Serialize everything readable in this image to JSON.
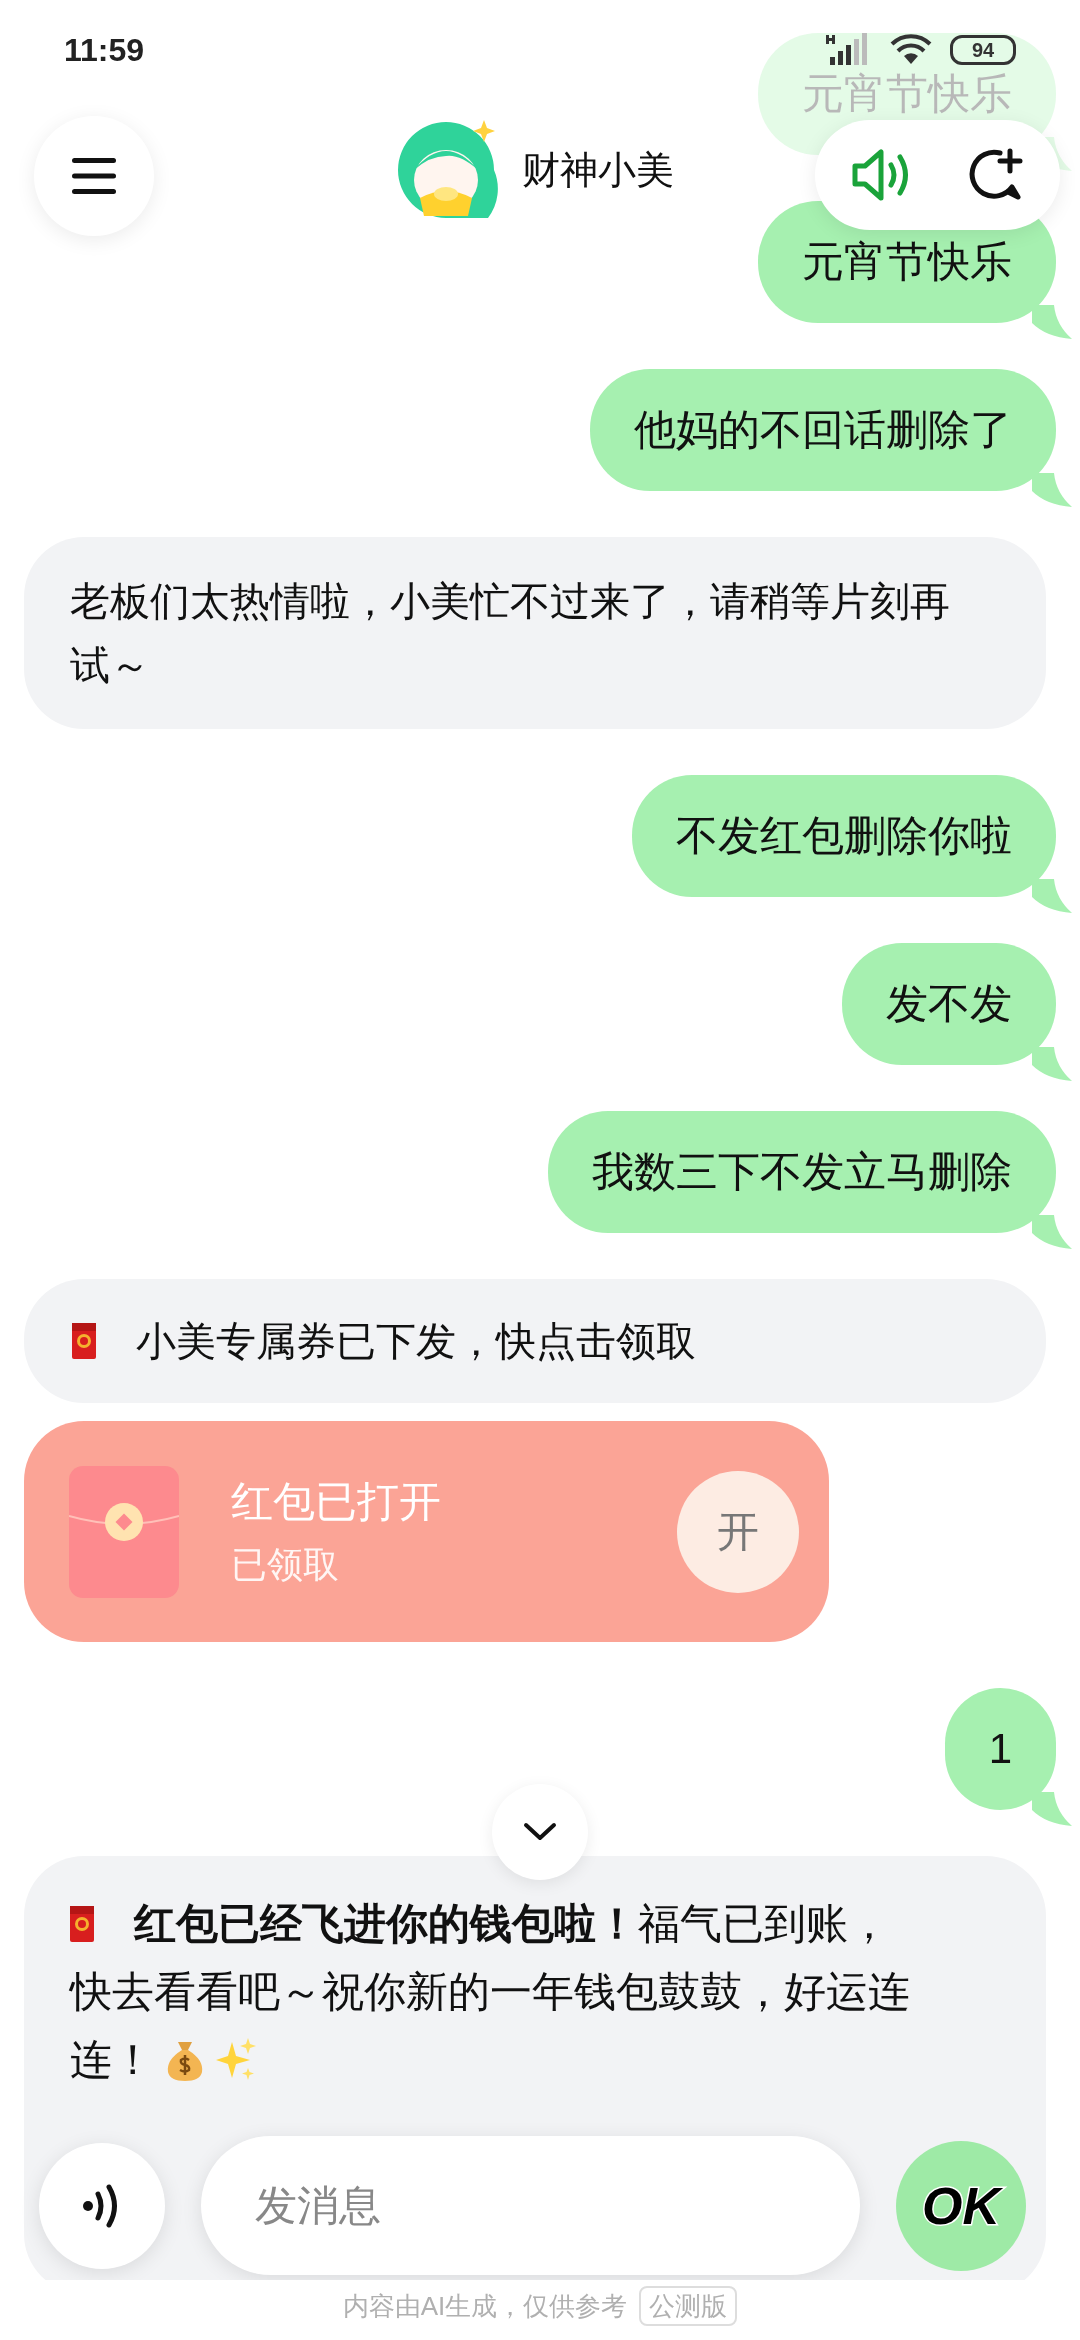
{
  "status_bar": {
    "time": "11:59",
    "battery": "94"
  },
  "header": {
    "title": "财神小美"
  },
  "messages": [
    {
      "kind": "user",
      "faded": true,
      "text": "元宵节快乐"
    },
    {
      "kind": "user",
      "faded": false,
      "text": "元宵节快乐"
    },
    {
      "kind": "user",
      "faded": false,
      "text": "他妈的不回话删除了"
    },
    {
      "kind": "bot",
      "faded": false,
      "text": "老板们太热情啦，小美忙不过来了，请稍等片刻再试～"
    },
    {
      "kind": "user",
      "faded": false,
      "text": "不发红包删除你啦"
    },
    {
      "kind": "user",
      "faded": false,
      "text": "发不发"
    },
    {
      "kind": "user",
      "faded": false,
      "text": "我数三下不发立马删除"
    },
    {
      "kind": "bot_coupon",
      "faded": false,
      "text": "小美专属券已下发，快点击领取"
    },
    {
      "kind": "red_packet",
      "faded": false,
      "title": "红包已打开",
      "subtitle": "已领取",
      "open_label": "开"
    },
    {
      "kind": "user",
      "faded": false,
      "text": "1"
    },
    {
      "kind": "bot_rich",
      "faded": false,
      "paragraphs": [
        "**红包已经飞进你的钱包啦！**福气已到账，快去看看吧～祝你新的一年钱包鼓鼓，好运连连！"
      ]
    }
  ],
  "input": {
    "placeholder": "发消息"
  },
  "send_button": {
    "label": "OK"
  },
  "footer": {
    "note": "内容由AI生成，仅供参考",
    "badge": "公测版"
  }
}
